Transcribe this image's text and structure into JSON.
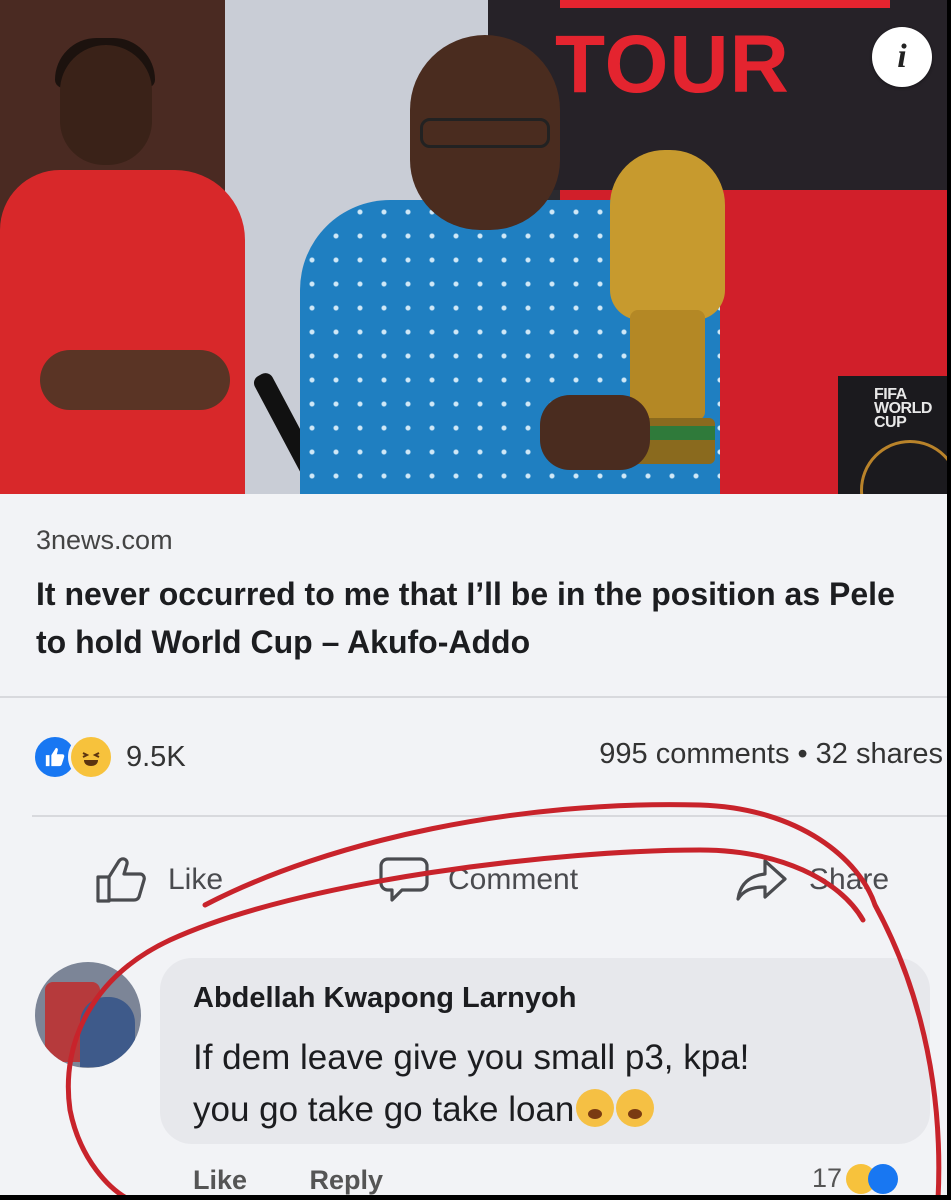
{
  "photo": {
    "banner_text": "TOUR",
    "fifa_line1": "FIFA",
    "fifa_line2": "WORLD",
    "fifa_line3": "CUP",
    "info_symbol": "i"
  },
  "post": {
    "source": "3news.com",
    "headline": "It never occurred to me that I’ll be in the position as Pele to hold World Cup – Akufo-Addo",
    "reaction_count": "9.5K",
    "comments_count": "995 comments",
    "dot": "•",
    "shares_count": "32 shares"
  },
  "actions": {
    "like": "Like",
    "comment": "Comment",
    "share": "Share"
  },
  "comment": {
    "author": "Abdellah Kwapong Larnyoh",
    "text_line1": "If dem leave give you small p3, kpa!",
    "text_line2": "you go take go take loan",
    "like_label": "Like",
    "reply_label": "Reply",
    "reaction_count": "17"
  },
  "colors": {
    "like_blue": "#1877f2",
    "annotation_red": "#c8232b"
  },
  "icons": [
    "info-icon",
    "like-reaction-icon",
    "haha-reaction-icon",
    "thumbs-up-icon",
    "comment-icon",
    "share-icon",
    "emoji-icon"
  ]
}
